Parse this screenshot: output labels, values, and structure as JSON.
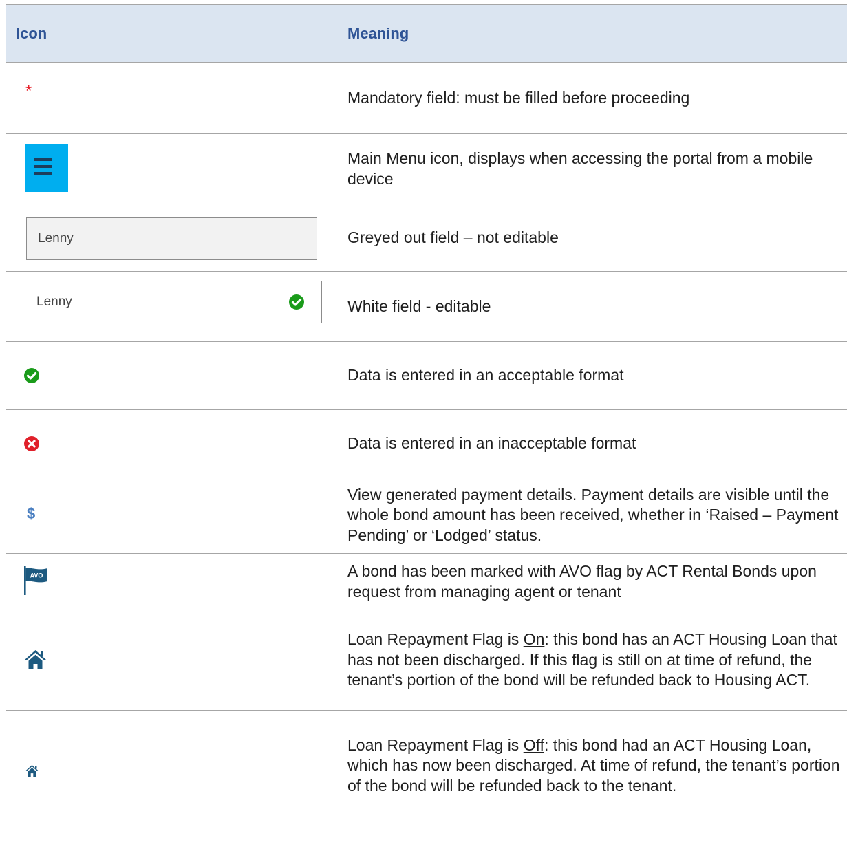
{
  "table": {
    "headers": {
      "icon": "Icon",
      "meaning": "Meaning"
    },
    "rows": [
      {
        "icon": "asterisk-icon",
        "icon_text": "*",
        "meaning": "Mandatory field: must be filled before proceeding"
      },
      {
        "icon": "hamburger-menu-icon",
        "meaning": "Main Menu icon, displays when accessing the portal from a mobile device"
      },
      {
        "icon": "greyed-field",
        "field_value": "Lenny",
        "meaning": "Greyed out field – not editable"
      },
      {
        "icon": "editable-field",
        "field_value": "Lenny",
        "meaning": "White field - editable"
      },
      {
        "icon": "green-check-icon",
        "meaning": "Data is entered in an acceptable format"
      },
      {
        "icon": "red-cross-icon",
        "meaning": "Data is entered in an inacceptable format"
      },
      {
        "icon": "dollar-icon",
        "icon_text": "$",
        "meaning": "View generated payment details. Payment details are visible until the whole bond amount has been received, whether in ‘Raised – Payment Pending’ or ‘Lodged’ status."
      },
      {
        "icon": "avo-flag-icon",
        "icon_text": "AVO",
        "meaning": "A bond has been marked with AVO flag by ACT Rental Bonds upon request from managing agent or tenant"
      },
      {
        "icon": "house-large-icon",
        "meaning_prefix": "Loan Repayment Flag is ",
        "meaning_flag": "On",
        "meaning_suffix": ": this bond has an ACT Housing Loan that has not been discharged. If this flag is still on at time of refund, the tenant’s portion of the bond will be refunded back to Housing ACT."
      },
      {
        "icon": "house-small-icon",
        "meaning_prefix": "Loan Repayment Flag is ",
        "meaning_flag": "Off",
        "meaning_suffix": ": this bond had an ACT Housing Loan, which has now been discharged. At time of refund, the tenant’s portion of the bond will be refunded back to the tenant."
      }
    ]
  },
  "colors": {
    "header_bg": "#dbe5f1",
    "header_text": "#2f5496",
    "hamburger_bg": "#00aeef",
    "check_green": "#1a9b1a",
    "cross_red": "#e0202a",
    "icon_blue": "#1d5a80"
  }
}
